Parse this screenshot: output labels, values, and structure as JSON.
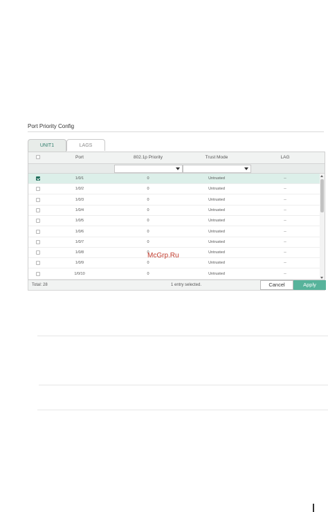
{
  "panel": {
    "title": "Port Priority Config"
  },
  "tabs": [
    {
      "label": "UNIT1",
      "active": true
    },
    {
      "label": "LAGS",
      "active": false
    }
  ],
  "columns": [
    "Port",
    "802.1p Priority",
    "Trust Mode",
    "LAG"
  ],
  "filters": {
    "priority_value": "",
    "trust_mode_value": ""
  },
  "rows": [
    {
      "port": "1/0/1",
      "priority": "0",
      "trust": "Untrusted",
      "lag": "--",
      "checked": true
    },
    {
      "port": "1/0/2",
      "priority": "0",
      "trust": "Untrusted",
      "lag": "--",
      "checked": false
    },
    {
      "port": "1/0/3",
      "priority": "0",
      "trust": "Untrusted",
      "lag": "--",
      "checked": false
    },
    {
      "port": "1/0/4",
      "priority": "0",
      "trust": "Untrusted",
      "lag": "--",
      "checked": false
    },
    {
      "port": "1/0/5",
      "priority": "0",
      "trust": "Untrusted",
      "lag": "--",
      "checked": false
    },
    {
      "port": "1/0/6",
      "priority": "0",
      "trust": "Untrusted",
      "lag": "--",
      "checked": false
    },
    {
      "port": "1/0/7",
      "priority": "0",
      "trust": "Untrusted",
      "lag": "--",
      "checked": false
    },
    {
      "port": "1/0/8",
      "priority": "0",
      "trust": "Untrusted",
      "lag": "--",
      "checked": false
    },
    {
      "port": "1/0/9",
      "priority": "0",
      "trust": "Untrusted",
      "lag": "--",
      "checked": false
    },
    {
      "port": "1/0/10",
      "priority": "0",
      "trust": "Untrusted",
      "lag": "--",
      "checked": false
    }
  ],
  "footer": {
    "total": "Total: 28",
    "selected": "1 entry selected.",
    "cancel_label": "Cancel",
    "apply_label": "Apply"
  },
  "watermark": "McGrp.Ru",
  "colors": {
    "accent": "#57b39b",
    "selected_row": "#dcefe9",
    "checkbox_on": "#1e6c5a"
  }
}
